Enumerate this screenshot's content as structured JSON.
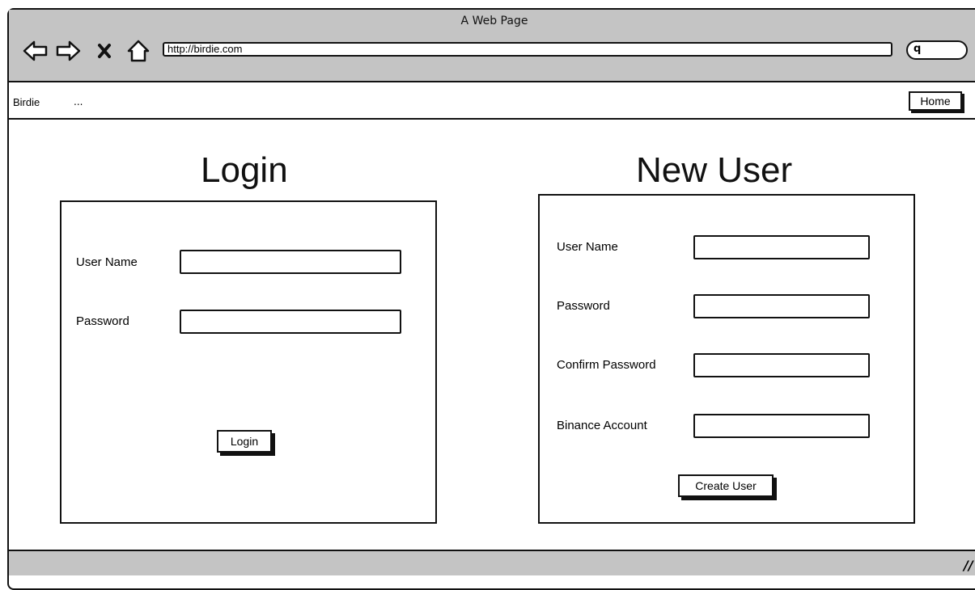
{
  "window": {
    "title": "A Web Page"
  },
  "toolbar": {
    "back_icon": "back-arrow-icon",
    "forward_icon": "forward-arrow-icon",
    "stop_icon": "close-icon",
    "home_icon": "home-icon",
    "url": "http://birdie.com",
    "search_icon": "search-icon",
    "search_glyph": "q"
  },
  "menubar": {
    "brand": "Birdie",
    "more": "...",
    "home_label": "Home"
  },
  "login": {
    "title": "Login",
    "username_label": "User Name",
    "password_label": "Password",
    "username_value": "",
    "password_value": "",
    "submit_label": "Login"
  },
  "new_user": {
    "title": "New User",
    "username_label": "User Name",
    "password_label": "Password",
    "confirm_label": "Confirm Password",
    "binance_label": "Binance Account",
    "username_value": "",
    "password_value": "",
    "confirm_value": "",
    "binance_value": "",
    "submit_label": "Create User"
  },
  "statusbar": {
    "grip_icon": "resize-grip-icon",
    "grip_glyph": "//"
  }
}
